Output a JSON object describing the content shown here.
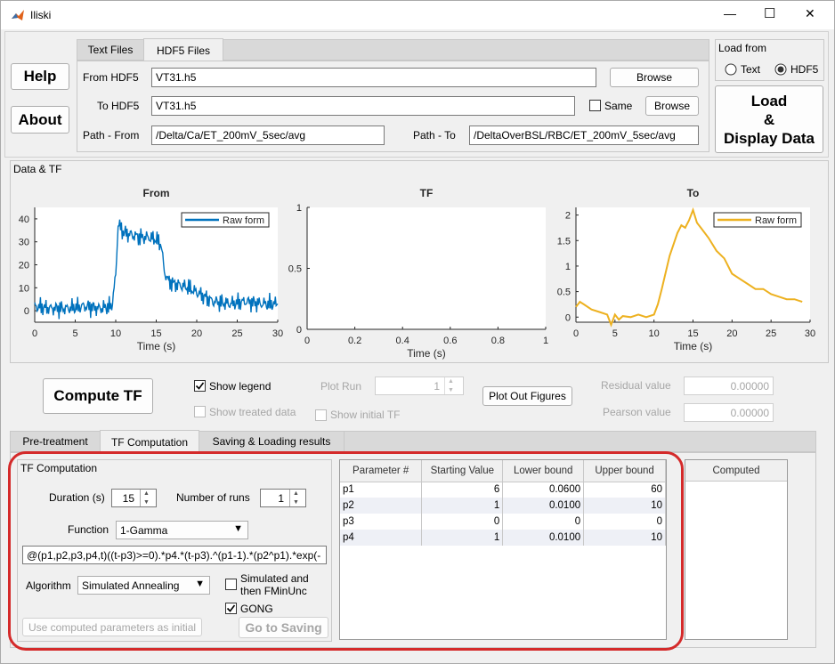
{
  "window": {
    "title": "Iliski",
    "minimize": "—",
    "maximize": "☐",
    "close": "✕"
  },
  "file_tabs": [
    "Text Files",
    "HDF5 Files"
  ],
  "hdf5": {
    "from_label": "From HDF5",
    "from_value": "VT31.h5",
    "browse1": "Browse",
    "to_label": "To HDF5",
    "to_value": "VT31.h5",
    "same_label": "Same",
    "browse2": "Browse",
    "path_from_label": "Path - From",
    "path_from_value": "/Delta/Ca/ET_200mV_5sec/avg",
    "path_to_label": "Path - To",
    "path_to_value": "/DeltaOverBSL/RBC/ET_200mV_5sec/avg"
  },
  "help_button": "Help",
  "about_button": "About",
  "load_from": {
    "title": "Load from",
    "options": [
      "Text",
      "HDF5"
    ],
    "selected": "HDF5"
  },
  "load_button": [
    "Load",
    "&",
    "Display Data"
  ],
  "data_tf": {
    "panel_title": "Data & TF",
    "plots": [
      {
        "title": "From",
        "xlabel": "Time (s)",
        "legend": "Raw form"
      },
      {
        "title": "TF",
        "xlabel": "Time (s)"
      },
      {
        "title": "To",
        "xlabel": "Time (s)",
        "legend": "Raw form"
      }
    ]
  },
  "chart_data": [
    {
      "type": "line",
      "title": "From",
      "xlabel": "Time (s)",
      "ylabel": "",
      "xlim": [
        0,
        30
      ],
      "ylim": [
        -5,
        45
      ],
      "xticks": [
        "0",
        "5",
        "10",
        "15",
        "20",
        "25",
        "30"
      ],
      "yticks": [
        "0",
        "10",
        "20",
        "30",
        "40"
      ],
      "legend_position": "top-right",
      "color": "#0072bd",
      "series": [
        {
          "name": "Raw form",
          "x": [
            0,
            2,
            4,
            6,
            8,
            9.5,
            10,
            10.3,
            10.6,
            11,
            12,
            13,
            14,
            15,
            15.6,
            16,
            16.5,
            17,
            18,
            19,
            20,
            21,
            22,
            24,
            26,
            28,
            30
          ],
          "y": [
            2,
            1,
            1,
            2,
            1,
            2,
            15,
            38,
            36,
            34,
            33,
            32,
            32,
            31,
            29,
            17,
            13,
            12,
            11,
            10,
            8,
            6,
            4,
            3,
            4,
            3,
            3
          ]
        }
      ]
    },
    {
      "type": "line",
      "title": "TF",
      "xlabel": "Time (s)",
      "ylabel": "",
      "xlim": [
        0,
        1
      ],
      "ylim": [
        0,
        1
      ],
      "xticks": [
        "0",
        "0.2",
        "0.4",
        "0.6",
        "0.8",
        "1"
      ],
      "yticks": [
        "0",
        "0.5",
        "1"
      ],
      "series": []
    },
    {
      "type": "line",
      "title": "To",
      "xlabel": "Time (s)",
      "ylabel": "",
      "xlim": [
        0,
        30
      ],
      "ylim": [
        -0.1,
        2.15
      ],
      "xticks": [
        "0",
        "5",
        "10",
        "15",
        "20",
        "25",
        "30"
      ],
      "yticks": [
        "0",
        "0.5",
        "1",
        "1.5",
        "2"
      ],
      "legend_position": "top-right",
      "color": "#edb120",
      "series": [
        {
          "name": "Raw form",
          "x": [
            0,
            0.5,
            1,
            2,
            3,
            4,
            4.5,
            5,
            5.5,
            6,
            7,
            8,
            9,
            10,
            10.5,
            11,
            12,
            13,
            13.5,
            14,
            14.5,
            15,
            15.5,
            16,
            17,
            18,
            19,
            20,
            21,
            22,
            23,
            24,
            25,
            26,
            27,
            28,
            29
          ],
          "y": [
            0.2,
            0.3,
            0.25,
            0.15,
            0.1,
            0.05,
            -0.15,
            0.05,
            -0.05,
            0.02,
            0.0,
            0.05,
            0.0,
            0.05,
            0.25,
            0.55,
            1.2,
            1.65,
            1.8,
            1.75,
            1.9,
            2.1,
            1.85,
            1.75,
            1.55,
            1.3,
            1.15,
            0.85,
            0.75,
            0.65,
            0.55,
            0.55,
            0.45,
            0.4,
            0.35,
            0.35,
            0.3
          ]
        }
      ]
    }
  ],
  "compute_button": "Compute TF",
  "show_legend": "Show legend",
  "show_treated": "Show treated data",
  "plot_run_label": "Plot Run",
  "plot_run_value": "1",
  "show_initial_tf": "Show initial TF",
  "plot_out_button": "Plot Out Figures",
  "residual_label": "Residual value",
  "residual_value": "0.00000",
  "pearson_label": "Pearson value",
  "pearson_value": "0.00000",
  "bottom_tabs": [
    "Pre-treatment",
    "TF Computation",
    "Saving & Loading results"
  ],
  "tf_comp": {
    "title": "TF Computation",
    "duration_label": "Duration (s)",
    "duration_value": "15",
    "runs_label": "Number of runs",
    "runs_value": "1",
    "function_label": "Function",
    "function_value": "1-Gamma",
    "formula": "@(p1,p2,p3,p4,t)((t-p3)>=0).*p4.*(t-p3).^(p1-1).*(p2^p1).*exp(-",
    "algorithm_label": "Algorithm",
    "algorithm_value": "Simulated Annealing",
    "sim_fmin_label": [
      "Simulated and",
      "then FMinUnc"
    ],
    "gong_label": "GONG",
    "use_computed_button": "Use computed parameters as initial",
    "go_saving_button": "Go to Saving"
  },
  "param_table": {
    "headers": [
      "Parameter #",
      "Starting Value",
      "Lower bound",
      "Upper bound"
    ],
    "rows": [
      [
        "p1",
        "6",
        "0.0600",
        "60"
      ],
      [
        "p2",
        "1",
        "0.0100",
        "10"
      ],
      [
        "p3",
        "0",
        "0",
        "0"
      ],
      [
        "p4",
        "1",
        "0.0100",
        "10"
      ]
    ]
  },
  "computed_header": "Computed",
  "highlight_color": "#d42a2a"
}
